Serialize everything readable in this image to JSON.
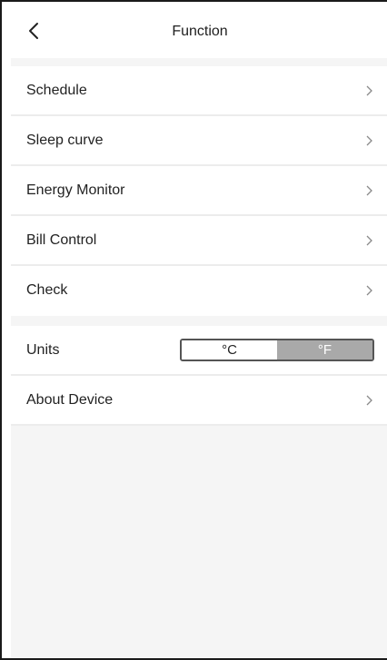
{
  "header": {
    "title": "Function",
    "back_icon": "chevron-left-icon"
  },
  "menu": {
    "items": [
      {
        "label": "Schedule",
        "icon": "chevron-right-icon"
      },
      {
        "label": "Sleep curve",
        "icon": "chevron-right-icon"
      },
      {
        "label": "Energy Monitor",
        "icon": "chevron-right-icon"
      },
      {
        "label": "Bill Control",
        "icon": "chevron-right-icon"
      },
      {
        "label": "Check",
        "icon": "chevron-right-icon"
      }
    ]
  },
  "settings": {
    "units": {
      "label": "Units",
      "options": [
        "°C",
        "°F"
      ],
      "selected": "°F"
    },
    "about": {
      "label": "About Device",
      "icon": "chevron-right-icon"
    }
  },
  "colors": {
    "background": "#f5f5f5",
    "divider": "#ececec",
    "toggle_selected": "#a9a9a9",
    "text": "#222222"
  }
}
